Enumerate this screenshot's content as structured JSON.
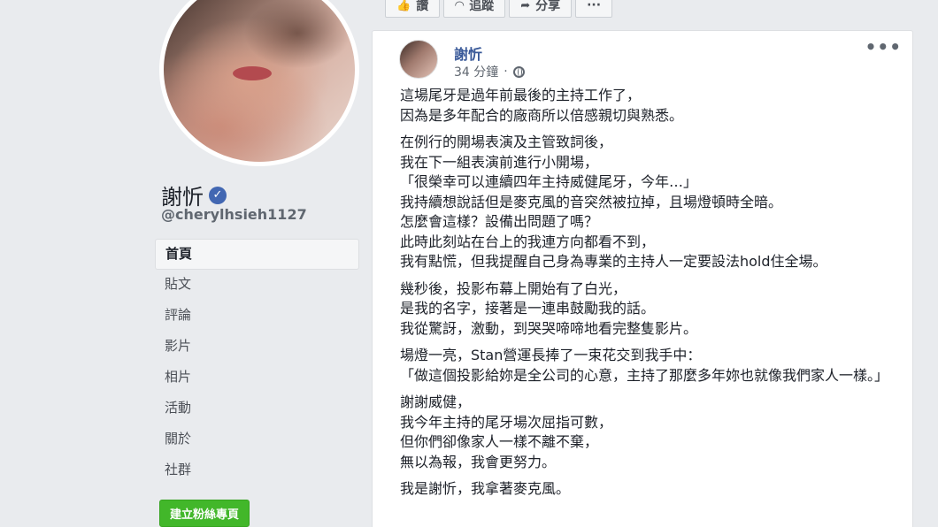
{
  "profile": {
    "name": "謝忻",
    "handle": "@cherylhsieh1127"
  },
  "sidebar": {
    "items": [
      {
        "label": "首頁",
        "active": true
      },
      {
        "label": "貼文",
        "active": false
      },
      {
        "label": "評論",
        "active": false
      },
      {
        "label": "影片",
        "active": false
      },
      {
        "label": "相片",
        "active": false
      },
      {
        "label": "活動",
        "active": false
      },
      {
        "label": "關於",
        "active": false
      },
      {
        "label": "社群",
        "active": false
      }
    ],
    "create_button": "建立粉絲專頁"
  },
  "action_bar": {
    "like_label": "讚",
    "follow_label": "追蹤",
    "share_label": "分享",
    "more_label": "···"
  },
  "post": {
    "author": "謝忻",
    "time": "34 分鐘",
    "more": "•••",
    "paragraphs": [
      [
        "這場尾牙是過年前最後的主持工作了，",
        "因為是多年配合的廠商所以倍感親切與熟悉。"
      ],
      [
        "在例行的開場表演及主管致詞後，",
        "我在下一組表演前進行小開場，",
        "「很榮幸可以連續四年主持威健尾牙，今年…」",
        "我持續想說話但是麥克風的音突然被拉掉，且場燈頓時全暗。",
        "怎麼會這樣？設備出問題了嗎？",
        "此時此刻站在台上的我連方向都看不到，",
        "我有點慌，但我提醒自己身為專業的主持人一定要設法hold住全場。"
      ],
      [
        "幾秒後，投影布幕上開始有了白光，",
        "是我的名字，接著是一連串鼓勵我的話。",
        "我從驚訝，激動，到哭哭啼啼地看完整隻影片。"
      ],
      [
        "場燈一亮，Stan營運長捧了一束花交到我手中：",
        "「做這個投影給妳是全公司的心意，主持了那麼多年妳也就像我們家人一樣。」"
      ],
      [
        "謝謝威健，",
        "我今年主持的尾牙場次屈指可數，",
        "但你們卻像家人一樣不離不棄，",
        "無以為報，我會更努力。"
      ],
      [
        "我是謝忻，我拿著麥克風。"
      ]
    ]
  },
  "icons": {
    "like": "thumbs-up-icon",
    "follow": "rss-icon",
    "share": "share-arrow-icon",
    "verified": "verified-badge-icon",
    "privacy": "globe-icon"
  },
  "colors": {
    "link": "#385898",
    "verified": "#4267b2",
    "create_button": "#42b72a",
    "background": "#e9ebee"
  }
}
